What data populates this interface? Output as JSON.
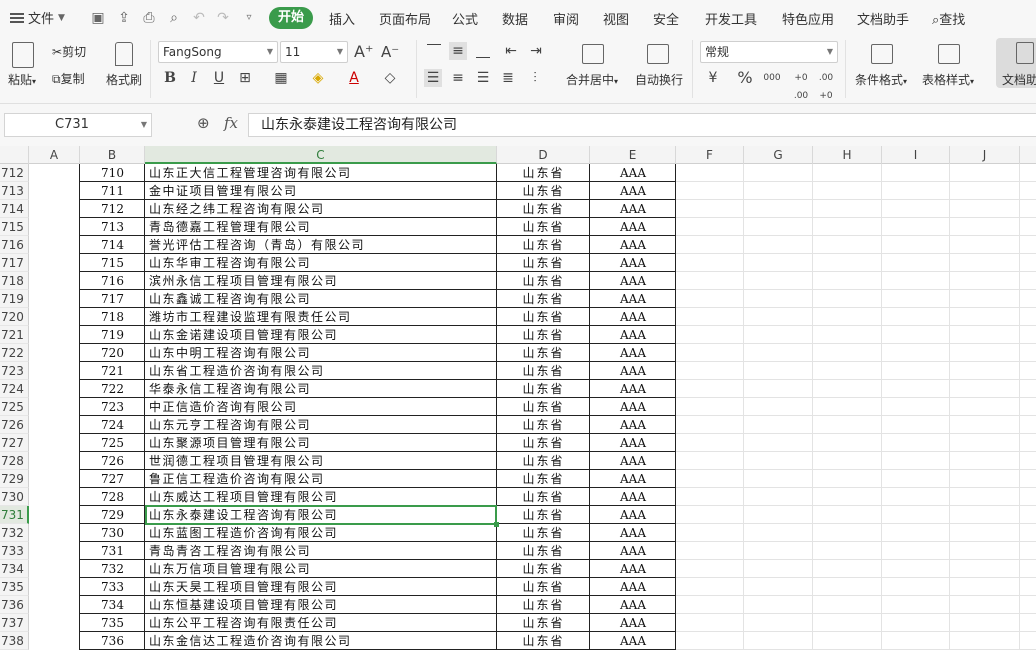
{
  "menu": {
    "file": "文件",
    "tabs": [
      {
        "label": "开始",
        "active": true
      },
      {
        "label": "插入"
      },
      {
        "label": "页面布局"
      },
      {
        "label": "公式"
      },
      {
        "label": "数据"
      },
      {
        "label": "审阅"
      },
      {
        "label": "视图"
      },
      {
        "label": "安全"
      },
      {
        "label": "开发工具"
      },
      {
        "label": "特色应用"
      },
      {
        "label": "文档助手"
      }
    ],
    "search": "查找"
  },
  "ribbon": {
    "paste": "粘贴",
    "cut": "剪切",
    "copy": "复制",
    "format_painter": "格式刷",
    "font_name": "FangSong",
    "font_size": "11",
    "bold": "B",
    "italic": "I",
    "underline": "U",
    "font_color": "A",
    "merge_center": "合并居中",
    "wrap_text": "自动换行",
    "number_format": "常规",
    "percent": "%",
    "thousands": "000",
    "inc_decimal": "+0 .00",
    "dec_decimal": ".00 +0",
    "cond_format": "条件格式",
    "table_style": "表格样式",
    "doc_assistant": "文档助",
    "accent_color": "#3a9b4b"
  },
  "formula_bar": {
    "name_box": "C731",
    "fx": "fx",
    "content": "山东永泰建设工程咨询有限公司"
  },
  "columns": [
    "A",
    "B",
    "C",
    "D",
    "E",
    "F",
    "G",
    "H",
    "I",
    "J"
  ],
  "selected_column": "C",
  "selected_row": "731",
  "rows": [
    {
      "r": "712",
      "b": "710",
      "c": "山东正大信工程管理咨询有限公司",
      "d": "山东省",
      "e": "AAA"
    },
    {
      "r": "713",
      "b": "711",
      "c": "金中证项目管理有限公司",
      "d": "山东省",
      "e": "AAA"
    },
    {
      "r": "714",
      "b": "712",
      "c": "山东经之纬工程咨询有限公司",
      "d": "山东省",
      "e": "AAA"
    },
    {
      "r": "715",
      "b": "713",
      "c": "青岛德嘉工程管理有限公司",
      "d": "山东省",
      "e": "AAA"
    },
    {
      "r": "716",
      "b": "714",
      "c": "誉光评估工程咨询（青岛）有限公司",
      "d": "山东省",
      "e": "AAA"
    },
    {
      "r": "717",
      "b": "715",
      "c": "山东华审工程咨询有限公司",
      "d": "山东省",
      "e": "AAA"
    },
    {
      "r": "718",
      "b": "716",
      "c": "滨州永信工程项目管理有限公司",
      "d": "山东省",
      "e": "AAA"
    },
    {
      "r": "719",
      "b": "717",
      "c": "山东鑫诚工程咨询有限公司",
      "d": "山东省",
      "e": "AAA"
    },
    {
      "r": "720",
      "b": "718",
      "c": "潍坊市工程建设监理有限责任公司",
      "d": "山东省",
      "e": "AAA"
    },
    {
      "r": "721",
      "b": "719",
      "c": "山东金诺建设项目管理有限公司",
      "d": "山东省",
      "e": "AAA"
    },
    {
      "r": "722",
      "b": "720",
      "c": "山东中明工程咨询有限公司",
      "d": "山东省",
      "e": "AAA"
    },
    {
      "r": "723",
      "b": "721",
      "c": "山东省工程造价咨询有限公司",
      "d": "山东省",
      "e": "AAA"
    },
    {
      "r": "724",
      "b": "722",
      "c": "华泰永信工程咨询有限公司",
      "d": "山东省",
      "e": "AAA"
    },
    {
      "r": "725",
      "b": "723",
      "c": "中正信造价咨询有限公司",
      "d": "山东省",
      "e": "AAA"
    },
    {
      "r": "726",
      "b": "724",
      "c": "山东元亨工程咨询有限公司",
      "d": "山东省",
      "e": "AAA"
    },
    {
      "r": "727",
      "b": "725",
      "c": "山东聚源项目管理有限公司",
      "d": "山东省",
      "e": "AAA"
    },
    {
      "r": "728",
      "b": "726",
      "c": "世润德工程项目管理有限公司",
      "d": "山东省",
      "e": "AAA"
    },
    {
      "r": "729",
      "b": "727",
      "c": "鲁正信工程造价咨询有限公司",
      "d": "山东省",
      "e": "AAA"
    },
    {
      "r": "730",
      "b": "728",
      "c": "山东威达工程项目管理有限公司",
      "d": "山东省",
      "e": "AAA"
    },
    {
      "r": "731",
      "b": "729",
      "c": "山东永泰建设工程咨询有限公司",
      "d": "山东省",
      "e": "AAA"
    },
    {
      "r": "732",
      "b": "730",
      "c": "山东蓝图工程造价咨询有限公司",
      "d": "山东省",
      "e": "AAA"
    },
    {
      "r": "733",
      "b": "731",
      "c": "青岛青咨工程咨询有限公司",
      "d": "山东省",
      "e": "AAA"
    },
    {
      "r": "734",
      "b": "732",
      "c": "山东万信项目管理有限公司",
      "d": "山东省",
      "e": "AAA"
    },
    {
      "r": "735",
      "b": "733",
      "c": "山东天昊工程项目管理有限公司",
      "d": "山东省",
      "e": "AAA"
    },
    {
      "r": "736",
      "b": "734",
      "c": "山东恒基建设项目管理有限公司",
      "d": "山东省",
      "e": "AAA"
    },
    {
      "r": "737",
      "b": "735",
      "c": "山东公平工程咨询有限责任公司",
      "d": "山东省",
      "e": "AAA"
    },
    {
      "r": "738",
      "b": "736",
      "c": "山东金信达工程造价咨询有限公司",
      "d": "山东省",
      "e": "AAA"
    }
  ]
}
